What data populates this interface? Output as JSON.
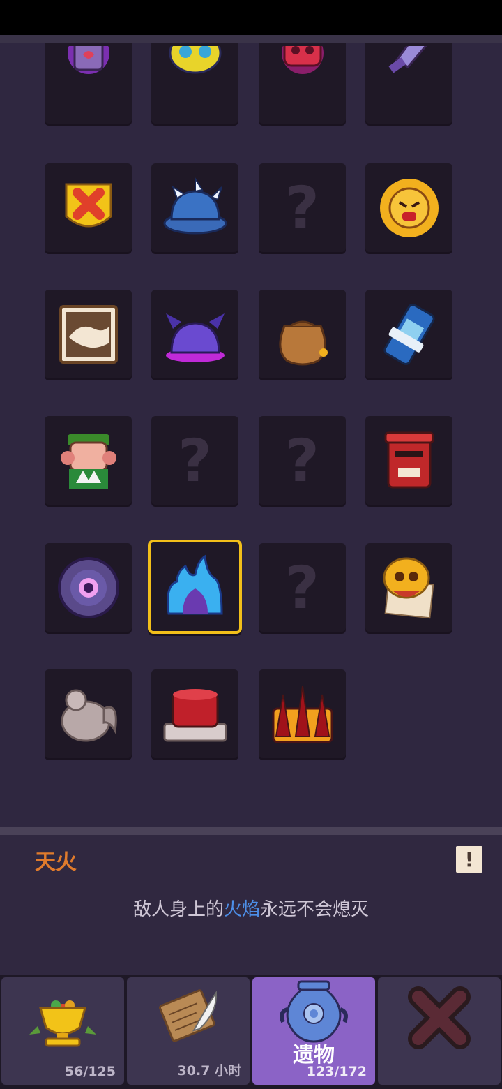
{
  "grid": {
    "selected_index": 17,
    "tiles": [
      {
        "icon": "purple-doll-icon",
        "unknown": false
      },
      {
        "icon": "blue-mask-icon",
        "unknown": false
      },
      {
        "icon": "red-skull-face-icon",
        "unknown": false
      },
      {
        "icon": "purple-sword-icon",
        "unknown": false
      },
      {
        "icon": "red-x-shield-icon",
        "unknown": false
      },
      {
        "icon": "spiked-blue-helmet-icon",
        "unknown": false
      },
      {
        "icon": "question-mark-icon",
        "unknown": true
      },
      {
        "icon": "angry-sun-icon",
        "unknown": false
      },
      {
        "icon": "handshake-card-icon",
        "unknown": false
      },
      {
        "icon": "purple-bat-hat-icon",
        "unknown": false
      },
      {
        "icon": "coin-sack-icon",
        "unknown": false
      },
      {
        "icon": "blue-phone-icon",
        "unknown": false
      },
      {
        "icon": "angry-farmer-icon",
        "unknown": false
      },
      {
        "icon": "question-mark-icon",
        "unknown": true
      },
      {
        "icon": "question-mark-icon",
        "unknown": true
      },
      {
        "icon": "red-mailbox-icon",
        "unknown": false
      },
      {
        "icon": "purple-eye-medallion-icon",
        "unknown": false
      },
      {
        "icon": "blue-flame-icon",
        "unknown": false
      },
      {
        "icon": "question-mark-icon",
        "unknown": true
      },
      {
        "icon": "skull-scroll-icon",
        "unknown": false
      },
      {
        "icon": "stone-rooster-icon",
        "unknown": false
      },
      {
        "icon": "red-button-icon",
        "unknown": false
      },
      {
        "icon": "bloody-spikes-icon",
        "unknown": false
      }
    ]
  },
  "info": {
    "title": "天火",
    "desc_before": "敌人身上的",
    "desc_highlight": "火焰",
    "desc_after": "永远不会熄灭",
    "alert_icon": "!"
  },
  "tabs": [
    {
      "icon": "golden-trophy-icon",
      "label": "",
      "count": "56/125",
      "active": false
    },
    {
      "icon": "scroll-quill-icon",
      "label": "",
      "count": "30.7  小时",
      "active": false
    },
    {
      "icon": "blue-vase-icon",
      "label": "遗物",
      "count": "123/172",
      "active": true
    },
    {
      "icon": "close-icon",
      "label": "",
      "count": "",
      "active": false
    }
  ],
  "colors": {
    "accent": "#8b63c6",
    "selected_border": "#f2bf1a",
    "highlight_text": "#4d8fe8",
    "title_text": "#e07b2c"
  }
}
